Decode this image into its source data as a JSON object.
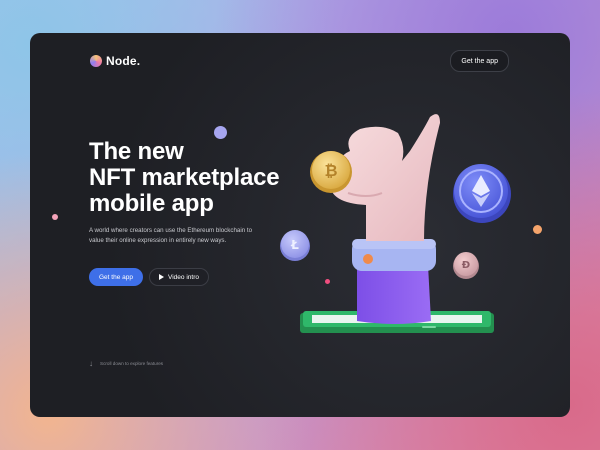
{
  "brand": {
    "name": "Node.",
    "logo_icon": "node-logo-icon"
  },
  "header": {
    "cta_label": "Get the app"
  },
  "hero": {
    "title_lines": [
      "The new",
      "NFT marketplace",
      "mobile app"
    ],
    "description": "A world where creators can use the Ethereum blockchain to value their online expression in entirely new ways.",
    "primary_button": "Get the app",
    "secondary_button": "Video intro",
    "secondary_icon": "play-icon"
  },
  "scroll_hint": {
    "label": "Scroll down to explore features",
    "icon": "arrow-down-icon"
  },
  "illustration": {
    "coins": [
      "bitcoin",
      "ethereum",
      "litecoin",
      "dash"
    ],
    "colors": {
      "accent": "#3e6fe8",
      "hand": "#f1cfd2",
      "sleeve": "#8a5cf0",
      "cuff": "#a7b5f2",
      "phone": "#2fb86a"
    }
  }
}
